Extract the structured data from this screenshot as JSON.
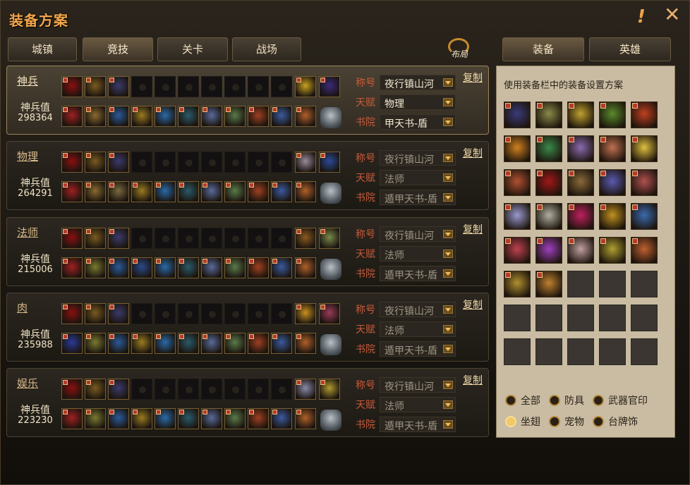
{
  "window": {
    "title": "装备方案",
    "close_glyph": "✕",
    "warn_glyph": "!"
  },
  "tabs": [
    {
      "label": "城镇",
      "active": false
    },
    {
      "label": "竞技",
      "active": true
    },
    {
      "label": "关卡",
      "active": false
    },
    {
      "label": "战场",
      "active": false
    }
  ],
  "layout_button": {
    "label": "布局"
  },
  "field_labels": {
    "title": "称号",
    "talent": "天赋",
    "academy": "书院",
    "power": "神兵值",
    "copy": "复制"
  },
  "plans": [
    {
      "name": "神兵",
      "power": "298364",
      "title": "夜行镇山河",
      "talent": "物理",
      "academy": "甲天书-盾",
      "selected": true,
      "top_colors": [
        "#8a1010",
        "#7a5a20",
        "#3a3a6a",
        "",
        "",
        "",
        "",
        "",
        "",
        "",
        "#c8a020",
        "#3a2a7a"
      ],
      "bottom_colors": [
        "#a02020",
        "#8a6a30",
        "#2a5a9a",
        "#9a7a20",
        "#2a6aaa",
        "#2a5a6a",
        "#5a6a9a",
        "#5a7a4a",
        "#a04020",
        "#3a5aa0",
        "#b0602a"
      ]
    },
    {
      "name": "物理",
      "power": "264291",
      "title": "夜行镇山河",
      "talent": "法师",
      "academy": "遁甲天书-盾",
      "selected": false,
      "top_colors": [
        "#8a1010",
        "#7a5a20",
        "#3a3a6a",
        "",
        "",
        "",
        "",
        "",
        "",
        "",
        "#9a8a9a",
        "#2a4a9a"
      ],
      "bottom_colors": [
        "#a02020",
        "#8a6a30",
        "#7a6a40",
        "#9a7a20",
        "#2a6aaa",
        "#2a5a6a",
        "#5a6a9a",
        "#5a7a4a",
        "#a04020",
        "#3a5aa0",
        "#b0602a"
      ]
    },
    {
      "name": "法师",
      "power": "215006",
      "title": "夜行镇山河",
      "talent": "法师",
      "academy": "遁甲天书-盾",
      "selected": false,
      "top_colors": [
        "#8a1010",
        "#7a5a20",
        "#3a3a6a",
        "",
        "",
        "",
        "",
        "",
        "",
        "",
        "#8a5a20",
        "#7a8a4a"
      ],
      "bottom_colors": [
        "#a02020",
        "#7a7a30",
        "#2a5a9a",
        "#2a4a8a",
        "#2a6aaa",
        "#2a5a6a",
        "#5a6a9a",
        "#5a7a4a",
        "#a04020",
        "#3a5aa0",
        "#b0602a"
      ]
    },
    {
      "name": "肉",
      "power": "235988",
      "title": "夜行镇山河",
      "talent": "法师",
      "academy": "遁甲天书-盾",
      "selected": false,
      "top_colors": [
        "#8a1010",
        "#7a5a20",
        "#3a3a6a",
        "",
        "",
        "",
        "",
        "",
        "",
        "",
        "#c89020",
        "#9a3a5a"
      ],
      "bottom_colors": [
        "#2a3a9a",
        "#7a7a30",
        "#2a5a9a",
        "#9a7a20",
        "#2a6aaa",
        "#2a5a6a",
        "#5a6a9a",
        "#5a7a4a",
        "#a04020",
        "#3a5aa0",
        "#b0602a"
      ]
    },
    {
      "name": "娱乐",
      "power": "223230",
      "title": "夜行镇山河",
      "talent": "法师",
      "academy": "遁甲天书-盾",
      "selected": false,
      "top_colors": [
        "#8a1010",
        "#7a5a20",
        "#3a3a6a",
        "",
        "",
        "",
        "",
        "",
        "",
        "",
        "#8a8aaa",
        "#b09a30"
      ],
      "bottom_colors": [
        "#a02020",
        "#7a7a30",
        "#2a5a9a",
        "#9a7a20",
        "#2a6aaa",
        "#2a5a6a",
        "#5a6a9a",
        "#5a7a4a",
        "#a04020",
        "#3a5aa0",
        "#b0602a"
      ]
    }
  ],
  "right_tabs": [
    {
      "label": "装备",
      "active": true
    },
    {
      "label": "英雄",
      "active": false
    }
  ],
  "right_panel": {
    "hint": "使用装备栏中的装备设置方案",
    "grid_colors": [
      "#3a3a7a",
      "#8a8a4a",
      "#c0a030",
      "#5a8a2a",
      "#c04020",
      "#d08020",
      "#3a8a4a",
      "#8a6ab0",
      "#c07050",
      "#e0c040",
      "#b05030",
      "#a01818",
      "#8a6a3a",
      "#5a5ab0",
      "#b05050",
      "#9a9ad0",
      "#b0b0a0",
      "#c02060",
      "#c09020",
      "#3a6ab0",
      "#c04050",
      "#a040c0",
      "#c0a0a0",
      "#b0a030",
      "#c06030",
      "#b09030",
      "#c08030",
      "",
      "",
      "",
      "",
      "",
      "",
      "",
      "",
      "",
      "",
      "",
      "",
      ""
    ],
    "filters": [
      {
        "label": "全部",
        "on": false
      },
      {
        "label": "防具",
        "on": false
      },
      {
        "label": "武器官印",
        "on": false
      },
      {
        "label": "坐翅",
        "on": true
      },
      {
        "label": "宠物",
        "on": false
      },
      {
        "label": "台牌饰",
        "on": false
      }
    ]
  }
}
